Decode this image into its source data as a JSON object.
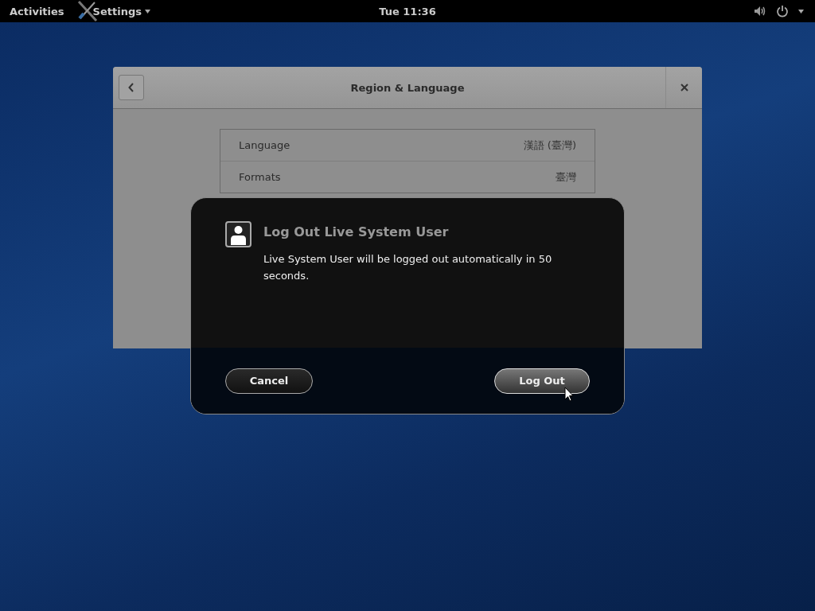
{
  "top_bar": {
    "activities": "Activities",
    "app_menu": "Settings",
    "clock": "Tue 11:36"
  },
  "settings_window": {
    "title": "Region & Language",
    "rows": [
      {
        "label": "Language",
        "value": "漢語 (臺灣)"
      },
      {
        "label": "Formats",
        "value": "臺灣"
      }
    ]
  },
  "dialog": {
    "title": "Log Out Live System User",
    "message": "Live System User will be logged out automatically in 50 seconds.",
    "buttons": [
      {
        "label": "Cancel",
        "default": false
      },
      {
        "label": "Log Out",
        "default": true
      }
    ]
  }
}
